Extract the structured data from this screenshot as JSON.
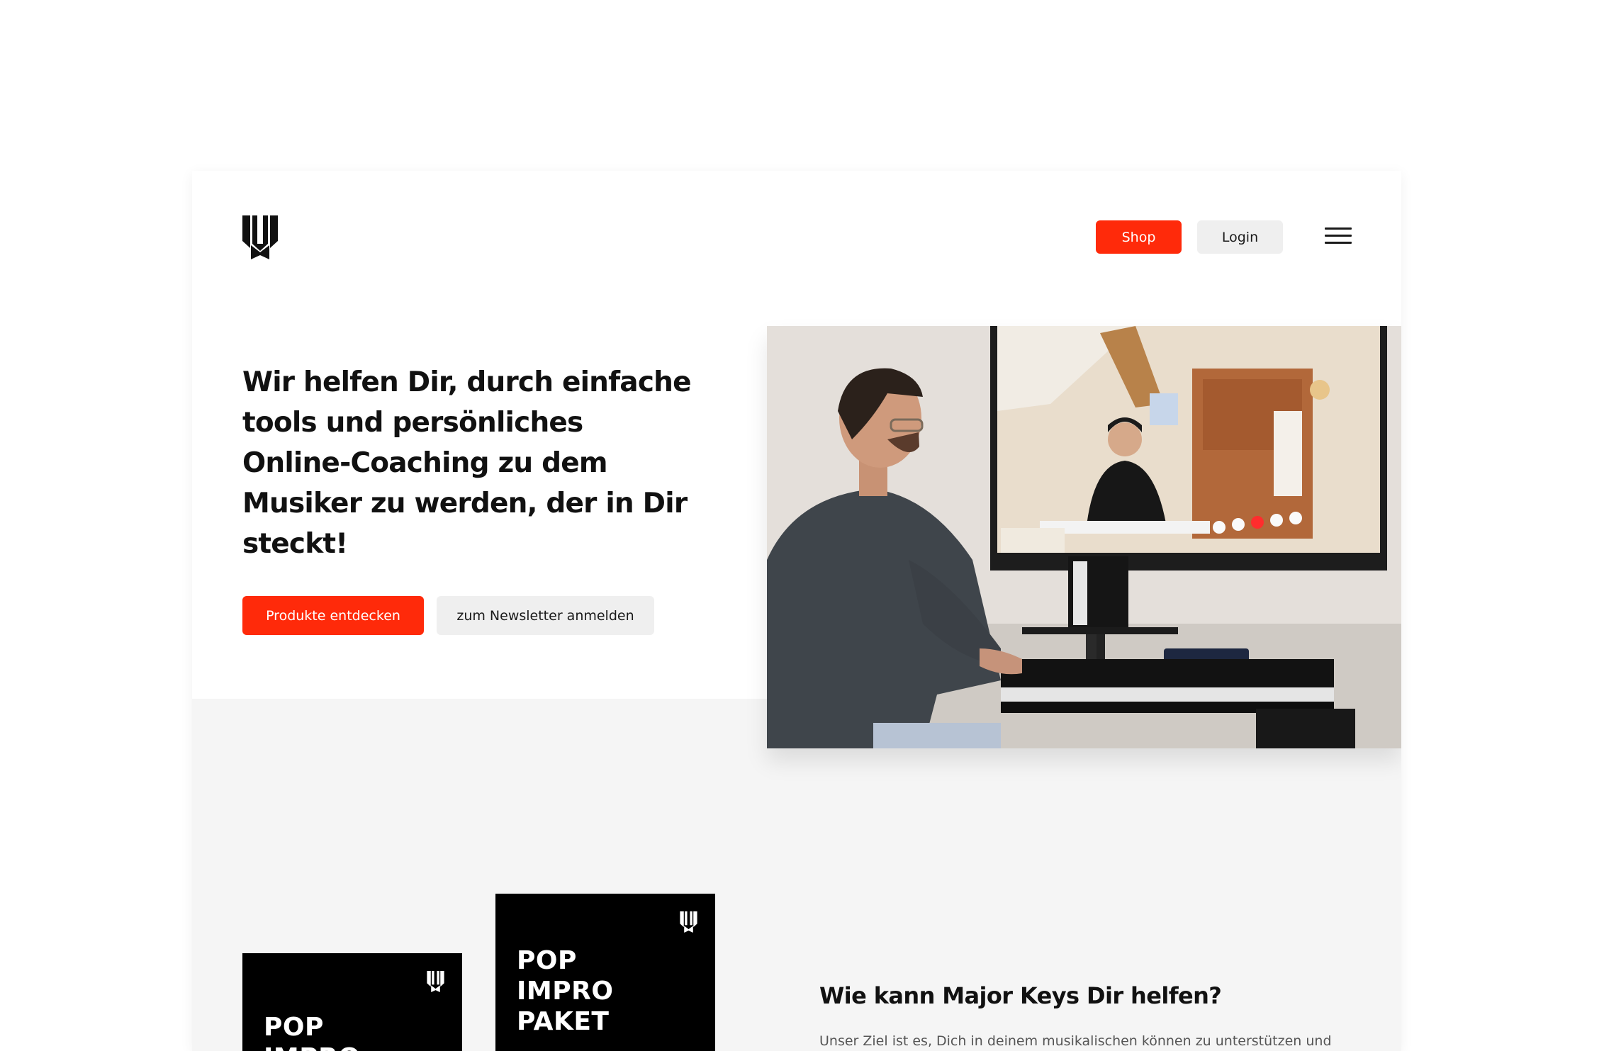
{
  "nav": {
    "logo_icon": "piano-keys-logo-icon",
    "shop_label": "Shop",
    "login_label": "Login",
    "menu_icon": "hamburger-menu-icon"
  },
  "hero": {
    "headline": "Wir helfen Dir, durch einfache tools und persönliches  Online-Coaching   zu dem Musiker zu werden, der in Dir steckt!",
    "primary_cta": "Produkte entdecken",
    "secondary_cta": "zum Newsletter anmelden",
    "image_alt": "Mann spielt Keyboard vor einem Monitor mit Online-Coaching"
  },
  "products": [
    {
      "title_lines": [
        "POP",
        "IMPRO"
      ]
    },
    {
      "title_lines": [
        "POP",
        "IMPRO",
        "PAKET"
      ]
    }
  ],
  "info": {
    "title": "Wie kann Major Keys Dir helfen?",
    "text": "Unser Ziel ist es, Dich in deinem musikalischen können zu unterstützen und"
  },
  "colors": {
    "accent": "#ff2a0a",
    "secondary_button": "#efefef",
    "section_background": "#f5f5f5",
    "text": "#111111"
  }
}
